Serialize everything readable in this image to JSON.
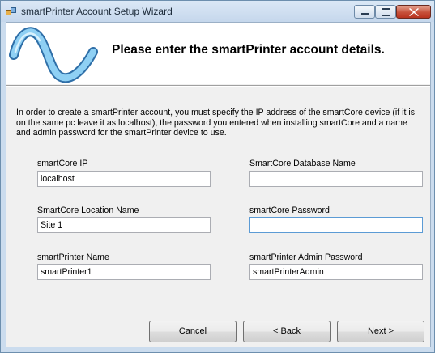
{
  "window": {
    "title": "smartPrinter Account Setup Wizard",
    "icon": "app-icon"
  },
  "header": {
    "title": "Please enter the smartPrinter account details.",
    "logo": "sine-wave-logo"
  },
  "intro": "In order to create a smartPrinter account, you must specify the IP address of the smartCore device (if it is on the same pc leave it as localhost), the password you entered when installing smartCore  and a name and admin password for the smartPrinter device to use.",
  "fields": {
    "smartcore_ip": {
      "label": "smartCore IP",
      "value": "localhost"
    },
    "database_name": {
      "label": "SmartCore Database Name",
      "value": ""
    },
    "location_name": {
      "label": "SmartCore Location Name",
      "value": "Site 1"
    },
    "smartcore_password": {
      "label": "smartCore Password",
      "value": ""
    },
    "printer_name": {
      "label": "smartPrinter Name",
      "value": "smartPrinter1"
    },
    "printer_admin_password": {
      "label": "smartPrinter Admin Password",
      "value": "smartPrinterAdmin"
    }
  },
  "buttons": {
    "cancel": "Cancel",
    "back": "< Back",
    "next": "Next >"
  },
  "colors": {
    "title_bar": "#c5d7ec",
    "close_button": "#c7503a",
    "logo_blue": "#6fb8e6",
    "focus_border": "#5b9bd5"
  }
}
